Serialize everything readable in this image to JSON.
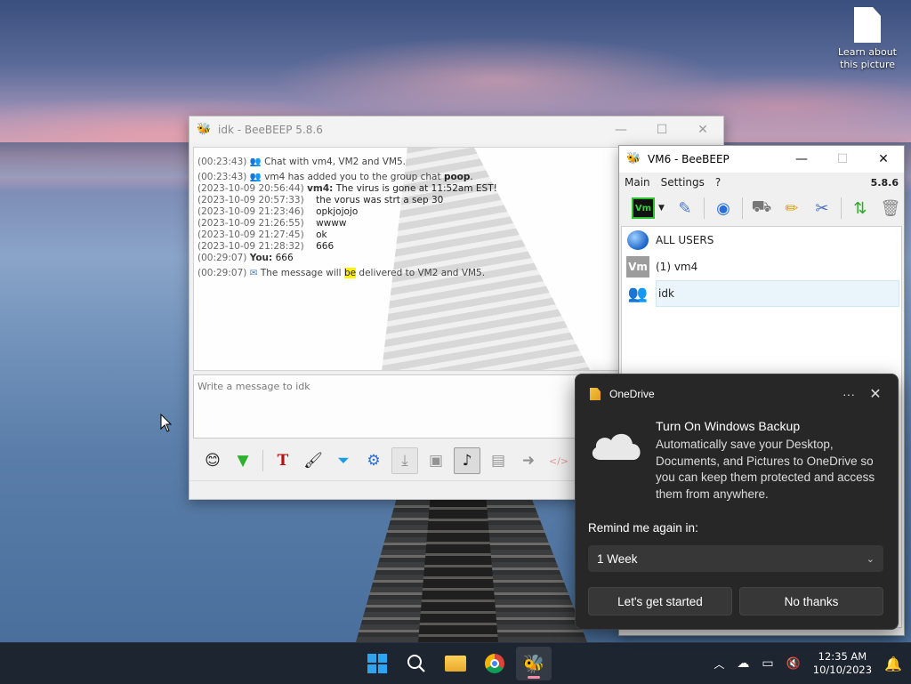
{
  "desktop": {
    "icon_label": "Learn about this picture"
  },
  "chat_window": {
    "title": "idk - BeeBEEP 5.8.6",
    "messages": [
      {
        "ts": "(00:23:43)",
        "who": "",
        "text": "Chat with vm4, VM2 and VM5.",
        "system": true
      },
      {
        "ts": "(00:23:43)",
        "who": "",
        "text_pre": "vm4 has added you to the group chat ",
        "text_bold": "poop",
        "text_post": ".",
        "system": true
      },
      {
        "ts": "(2023-10-09 20:56:44)",
        "who": "vm4:",
        "text": "The virus is gone at 11:52am EST!"
      },
      {
        "ts": "(2023-10-09 20:57:33)",
        "who": "",
        "text": "the vorus was strt a sep 30"
      },
      {
        "ts": "(2023-10-09 21:23:46)",
        "who": "",
        "text": "opkjojojo"
      },
      {
        "ts": "(2023-10-09 21:26:55)",
        "who": "",
        "text": "wwww"
      },
      {
        "ts": "(2023-10-09 21:27:45)",
        "who": "",
        "text": "ok"
      },
      {
        "ts": "(2023-10-09 21:28:32)",
        "who": "",
        "text": "666"
      },
      {
        "ts": "(00:29:07)",
        "who": "You:",
        "text": "666"
      },
      {
        "ts": "(00:29:07)",
        "who": "",
        "text_pre": "The message will ",
        "text_hl": "be",
        "text_post": " delivered to VM2 and VM5.",
        "system": true
      }
    ],
    "input_placeholder": "Write a message to idk"
  },
  "main_window": {
    "title": "VM6 - BeeBEEP",
    "menu": [
      "Main",
      "Settings",
      "?"
    ],
    "version": "5.8.6",
    "status_badge": "Vm",
    "users": [
      {
        "label": "ALL USERS",
        "icon": "globe-users-icon"
      },
      {
        "label": "(1) vm4",
        "icon": "vm-avatar",
        "avatar_text": "Vm"
      },
      {
        "label": "idk",
        "icon": "group-icon"
      }
    ]
  },
  "toast": {
    "app_name": "OneDrive",
    "title": "Turn On Windows Backup",
    "body": "Automatically save your Desktop, Documents, and Pictures to OneDrive so you can keep them protected and access them from anywhere.",
    "remind_label": "Remind me again in:",
    "remind_value": "1 Week",
    "primary_button": "Let's get started",
    "secondary_button": "No thanks"
  },
  "taskbar": {
    "time": "12:35 AM",
    "date": "10/10/2023"
  }
}
